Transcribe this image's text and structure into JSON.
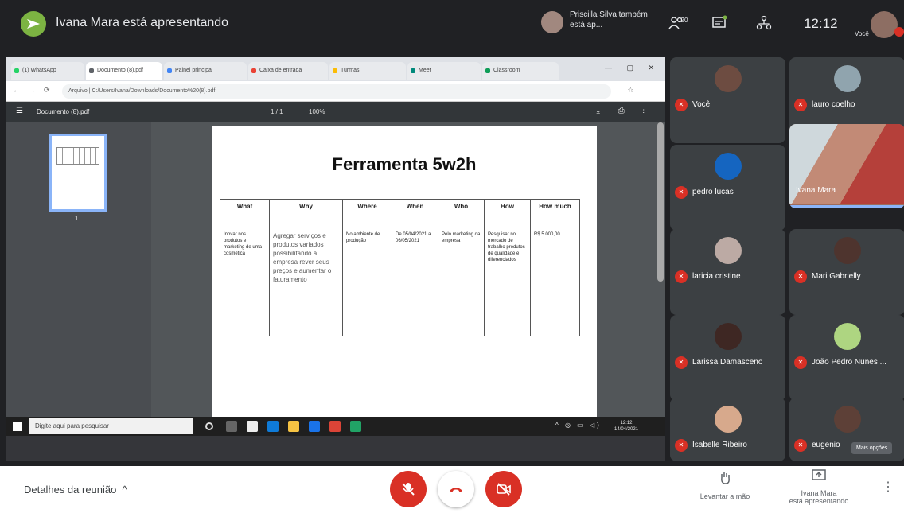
{
  "topbar": {
    "presenting_title": "Ivana Mara está apresentando",
    "also_presenting": "Priscilla Silva também está ap...",
    "participants_icon_count": "20",
    "clock": "12:12",
    "self_label": "Você"
  },
  "browser": {
    "tabs": [
      "(1) WhatsApp",
      "Documento (8).pdf",
      "Painel principal",
      "Caixa de entrada",
      "Turmas",
      "Meet",
      "Classroom"
    ],
    "address": "Arquivo | C:/Users/Ivana/Downloads/Documento%20(8).pdf"
  },
  "pdf": {
    "file_name": "Documento (8).pdf",
    "page_indicator": "1 / 1",
    "zoom": "100%",
    "thumb_page_number": "1",
    "title": "Ferramenta 5w2h",
    "table": {
      "headers": [
        "What",
        "Why",
        "Where",
        "When",
        "Who",
        "How",
        "How much"
      ],
      "row": [
        "Inovar nos produtos e marketing de uma cosmética",
        "Agregar serviços e produtos variados possibilitando à empresa rever seus preços e aumentar o faturamento",
        "No ambiente de produção",
        "De 05/04/2021 a 06/05/2021",
        "Pelo marketing da empresa",
        "Pesquisar no mercado de trabalho produtos de qualidade e diferenciados",
        "R$ 5.000,00"
      ]
    }
  },
  "taskbar": {
    "search_placeholder": "Digite aqui para pesquisar",
    "time": "12:12",
    "date": "14/04/2021"
  },
  "participants": [
    {
      "name": "Você"
    },
    {
      "name": "lauro coelho"
    },
    {
      "name": "pedro lucas"
    },
    {
      "name": "Ivana Mara"
    },
    {
      "name": "laricia cristine"
    },
    {
      "name": "Mari Gabrielly"
    },
    {
      "name": "Larissa Damasceno"
    },
    {
      "name": "João Pedro Nunes ..."
    },
    {
      "name": "Isabelle Ribeiro"
    },
    {
      "name": "eugenio"
    }
  ],
  "tooltip": "Mais opções",
  "bottombar": {
    "details": "Detalhes da reunião",
    "raise_hand": "Levantar a mão",
    "presenting_line1": "Ivana Mara",
    "presenting_line2": "está apresentando"
  },
  "colors": {
    "danger": "#d93025",
    "presenter_green": "#7cb342",
    "active_speaker": "#8ab4f8"
  }
}
